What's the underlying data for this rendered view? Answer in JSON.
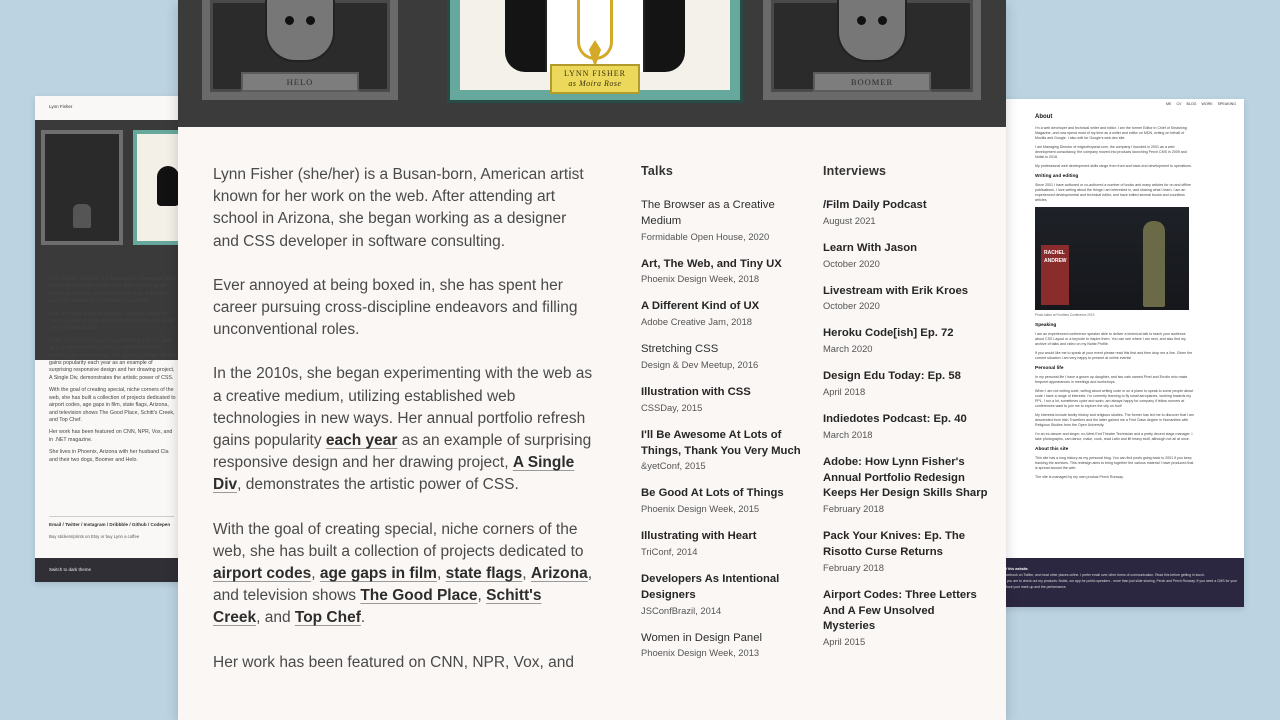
{
  "left_page": {
    "name": "Lynn Fisher",
    "paragraphs": [
      [
        "Lynn Fisher (she/her) is a Busan-born, American artist known for her work on the web. After attending art school in Arizona, she began working as a designer and CSS developer in software consulting."
      ],
      [
        "Ever annoyed at being boxed in, she has spent her career pursuing cross-discipline endeavors and filling unconventional roles."
      ],
      [
        "In the 2010s, she began experimenting with the web as a creative medium, utilizing established web technologies in new ways. Her annual portfolio refresh gains popularity each year as an example of surprising responsive design and her drawing project, A Single Div, demonstrates the artistic power of CSS."
      ],
      [
        "With the goal of creating special, niche corners of the web, she has built a collection of projects dedicated to airport codes, age gaps in film, state flags, Arizona, and television shows The Good Place, Schitt's Creek, and Top Chef."
      ],
      [
        "Her work has been featured on CNN, NPR, Vox, and in .NET magazine."
      ],
      [
        "She lives in Phoenix, Arizona with her husband Cla and their two dogs, Boomer and Helo."
      ]
    ],
    "links": "Email / Twitter / Instagram / Dribbble / Github / Codepen",
    "sub": "Buy stickers/prints on Etsy or buy Lynn a coffee",
    "footer": "Switch to dark theme"
  },
  "right_page": {
    "nav": [
      "ME",
      "CV",
      "BLOG",
      "WORK",
      "SPEAKING"
    ],
    "about_title": "About",
    "about_p1": "I'm a web developer and technical writer and editor. I am the former Editor in Chief of Smashing Magazine, and now spend most of my time as a writer and editor on MDN, writing on behalf of Mozilla and Google. I also edit for Google's web.dev site.",
    "about_p2": "I am Managing Director of edgeofmyseat.com, the company I founded in 2001 as a web development consultancy, the company moved into products launching Perch CMS in 2009 and Notist in 2018.",
    "about_p3": "My professional web development skills range from front and back-end development to operations.",
    "writing_title": "Writing and editing",
    "writing_p": "Since 2001 I have authored or co-authored a number of books and many articles for on and offline publications. I love writing about the things I am interested in, and sharing what I learn. I am an experienced developmental and technical editor, and have edited several books and countless articles.",
    "photo_banner": "RACHEL ANDREW",
    "photo_caption": "Photo taken at Frontiers Conference 2019",
    "speaking_title": "Speaking",
    "speaking_p1": "I am an experienced conference speaker able to deliver a technical talk to teach your audience about CSS Layout or a keynote to inspire them. You can see where I am next, and also find my archive of talks and video on my Notist Profile.",
    "speaking_p2": "If you would like me to speak at your event please read this first and then drop me a line. Given the current situation I am very happy to present at online events!",
    "personal_title": "Personal life",
    "personal_p1": "In my personal life I have a grown up daughter, and two cats named Pixel and Errolin who make frequent appearances in meetings and workshops.",
    "personal_p2": "When I am not writing code, writing about writing code or on a plane to speak to some people about code I have a range of interests. I'm currently learning to fly small aeroplanes, working towards my PPL. I run a lot, sometimes cycle and swim, am always happy for company if fellow runners at conferences want to join me to explore the city on foot!",
    "personal_p3": "My interests include family history and religious studies. The former has led me to discover that I am descended from Irish Travellers and the latter gained me a First Class degree in Humanities with Religious Studies from the Open University.",
    "personal_p4": "I'm an ex-dancer and singer, ex-West End Theatre Technician and a pretty decent stage manager. I take photographs, can dance, make, cook, read Latin and lift heavy stuff, although not all at once.",
    "site_title": "About this site",
    "site_p1": "This site has a long history as my personal blog. You can find posts going back to 2001 if you keep tracking the archives. This redesign aims to bring together the various material I have produced that is spread around the web.",
    "site_p2": "The site is managed by my own product Perch Runway.",
    "footer_l1": "of this website.",
    "footer_l2": "facebook on Twitter, and most other places online. I prefer email over other forms of communication. Read this before getting in touch.",
    "footer_l3": "If you are to check out my products: Notist, our app for public speakers - more than just slide sharing, Perch and Perch Runway. If you need a CMS for your about your mark-up and the performance."
  },
  "hero": {
    "left_name": "HELO",
    "center_name": "LYNN FISHER",
    "center_sub": "as Moira Rose",
    "right_name": "BOOMER"
  },
  "bio": {
    "p1": "Lynn Fisher (she/her) is a Busan-born, American artist known for her work on the web. After attending art school in Arizona, she began working as a designer and CSS developer in software consulting.",
    "p2": "Ever annoyed at being boxed in, she has spent her career pursuing cross-discipline endeavors and filling unconventional roles.",
    "p3_a": "In the 2010s, she began experimenting with the web as a creative medium, utilizing established web technologies in new ways. Her annual portfolio refresh gains popularity ",
    "p3_link1": "each year",
    "p3_b": " as an example of surprising responsive design and her drawing project, ",
    "p3_link2": "A Single Div",
    "p3_c": ", demonstrates the artistic power of CSS.",
    "p4_a": "With the goal of creating special, niche corners of the web, she has built a collection of projects dedicated to ",
    "p4_link1": "airport codes",
    "p4_sep1": ", ",
    "p4_link2": "age gaps in film",
    "p4_sep2": ", ",
    "p4_link3": "state flags",
    "p4_sep3": ", ",
    "p4_link4": "Arizona",
    "p4_b": ", and television shows ",
    "p4_link5": "The Good Place",
    "p4_sep4": ", ",
    "p4_link6": "Schitt's Creek",
    "p4_c": ", and ",
    "p4_link7": "Top Chef",
    "p4_d": ".",
    "p5": "Her work has been featured on CNN, NPR, Vox, and"
  },
  "talks": {
    "heading": "Talks",
    "items": [
      {
        "title": "The Browser as a Creative Medium",
        "meta": "Formidable Open House, 2020",
        "bold": false
      },
      {
        "title": "Art, The Web, and Tiny UX",
        "meta": "Phoenix Design Week, 2018",
        "bold": true
      },
      {
        "title": "A Different Kind of UX",
        "meta": "Adobe Creative Jam, 2018",
        "bold": true
      },
      {
        "title": "Stretching CSS",
        "meta": "Design & Dev Meetup, 2016",
        "bold": false
      },
      {
        "title": "Illustration with CSS",
        "meta": "CSSDay, 2015",
        "bold": true
      },
      {
        "title": "I'll Be Awesome At Lots of Things, Thank You Very Much",
        "meta": "&yetConf, 2015",
        "bold": true
      },
      {
        "title": "Be Good At Lots of Things",
        "meta": "Phoenix Design Week, 2015",
        "bold": true
      },
      {
        "title": "Illustrating with Heart",
        "meta": "TriConf, 2014",
        "bold": true
      },
      {
        "title": "Developers As Intentional Designers",
        "meta": "JSConfBrazil, 2014",
        "bold": true
      },
      {
        "title": "Women in Design Panel",
        "meta": "Phoenix Design Week, 2013",
        "bold": false
      }
    ]
  },
  "interviews": {
    "heading": "Interviews",
    "items": [
      {
        "title": "/Film Daily Podcast",
        "meta": "August 2021"
      },
      {
        "title": "Learn With Jason",
        "meta": "October 2020"
      },
      {
        "title": "Livestream with Erik Kroes",
        "meta": "October 2020"
      },
      {
        "title": "Heroku Code[ish] Ep. 72",
        "meta": "March 2020"
      },
      {
        "title": "Design Edu Today: Ep. 58",
        "meta": "April 2018"
      },
      {
        "title": "Indiedotes Podcast: Ep. 40",
        "meta": "March 2018"
      },
      {
        "title": "Adobe: How Lynn Fisher's Annual Portfolio Redesign Keeps Her Design Skills Sharp",
        "meta": "February 2018"
      },
      {
        "title": "Pack Your Knives: Ep. The Risotto Curse Returns",
        "meta": "February 2018"
      },
      {
        "title": "Airport Codes: Three Letters And A Few Unsolved Mysteries",
        "meta": "April 2015"
      }
    ]
  }
}
